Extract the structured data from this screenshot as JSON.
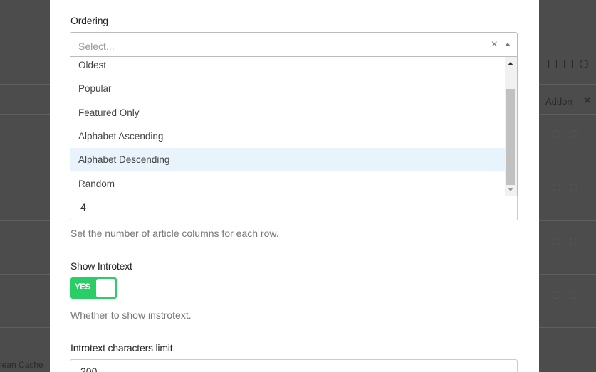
{
  "background": {
    "addon_label": "Addon",
    "clean_cache_label": "lean Cache"
  },
  "ordering": {
    "label": "Ordering",
    "placeholder": "Select...",
    "clear_symbol": "×",
    "options": [
      "Oldest",
      "Popular",
      "Featured Only",
      "Alphabet Ascending",
      "Alphabet Descending",
      "Random"
    ],
    "highlighted": "Alphabet Descending"
  },
  "columns": {
    "value": "4",
    "help": "Set the number of article columns for each row."
  },
  "show_introtext": {
    "label": "Show Introtext",
    "toggle_label": "YES",
    "state": "on",
    "help": "Whether to show instrotext."
  },
  "introtext_limit": {
    "label": "Introtext characters limit.",
    "value": "200"
  },
  "colors": {
    "toggle_on": "#2bce66",
    "highlight": "#e9f3fc",
    "backdrop": "#4c4c4c"
  }
}
